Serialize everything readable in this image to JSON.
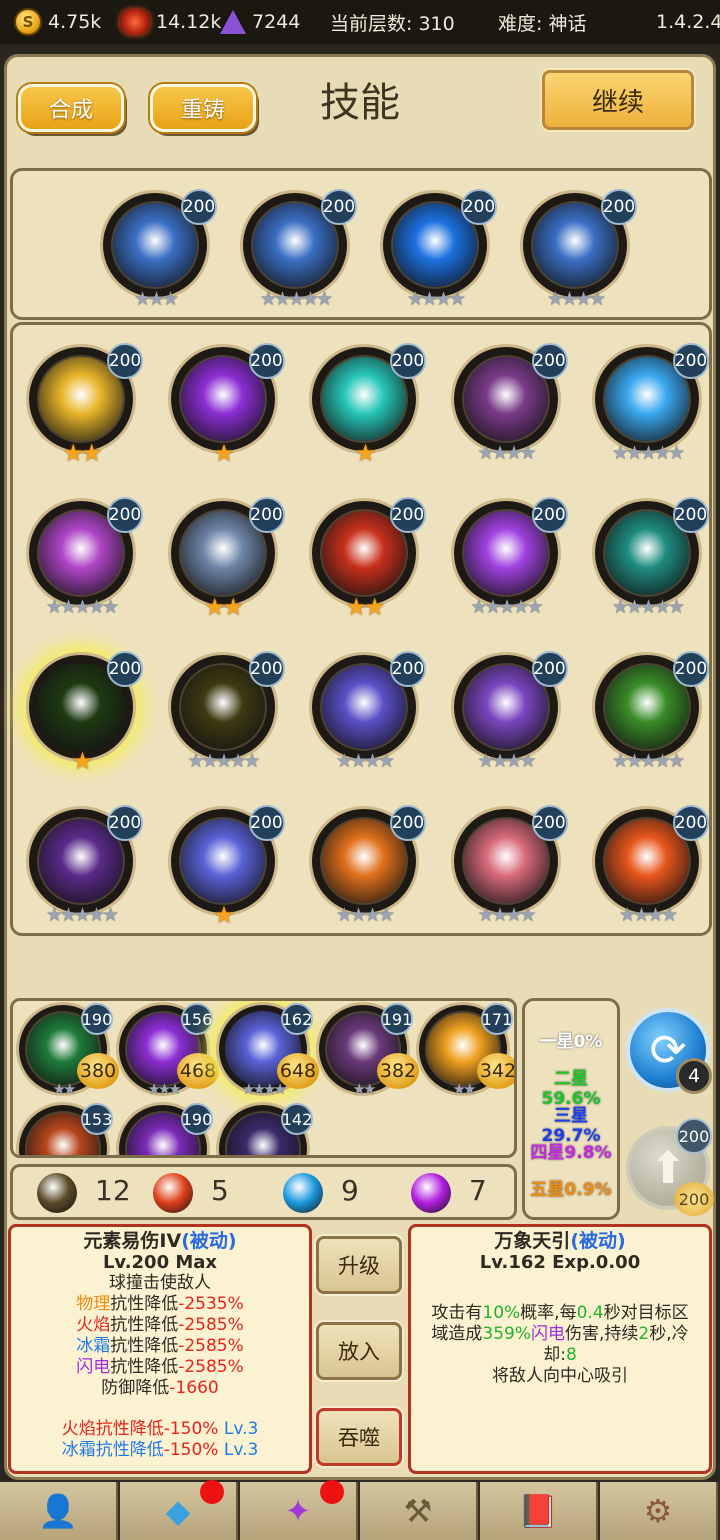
{
  "topbar": {
    "gold": "4.75k",
    "ore": "14.12k",
    "gems": "7244",
    "floor": "当前层数: 310",
    "difficulty": "难度: 神话",
    "version": "1.4.2.4",
    "coin_icon_glyph": "S"
  },
  "header": {
    "merge": "合成",
    "recast": "重铸",
    "title": "技能",
    "continue": "继续"
  },
  "equipped": [
    {
      "icon": "rock-ice-icon",
      "level": "200",
      "stars": "★★★",
      "color": "#3a6fc4"
    },
    {
      "icon": "rock-ice-icon",
      "level": "200",
      "stars": "★★★★★",
      "color": "#3a6fc4"
    },
    {
      "icon": "blue-energy-icon",
      "level": "200",
      "stars": "★★★★",
      "color": "#1c70e0"
    },
    {
      "icon": "rock-ice-icon",
      "level": "200",
      "stars": "★★★★",
      "color": "#3a6fc4"
    }
  ],
  "skills": [
    {
      "icon": "gold-card-icon",
      "level": "200",
      "stars": "★★",
      "gold": true,
      "color": "#e8b52a"
    },
    {
      "icon": "purple-lightning-icon",
      "level": "200",
      "stars": "★",
      "gold": true,
      "color": "#8c2ed4"
    },
    {
      "icon": "cyan-blades-icon",
      "level": "200",
      "stars": "★",
      "gold": true,
      "color": "#27c7b8"
    },
    {
      "icon": "fire-purple-icon",
      "level": "200",
      "stars": "★★★★",
      "gold": false,
      "color": "#7a3b8a"
    },
    {
      "icon": "blue-burst-icon",
      "level": "200",
      "stars": "★★★★★",
      "gold": false,
      "color": "#3aa8f0"
    },
    {
      "icon": "pink-vortex-icon",
      "level": "200",
      "stars": "★★★★★",
      "gold": false,
      "color": "#b046c8"
    },
    {
      "icon": "rock-cluster-icon",
      "level": "200",
      "stars": "★★",
      "gold": true,
      "color": "#6f86a8"
    },
    {
      "icon": "fire-warrior-icon",
      "level": "200",
      "stars": "★★",
      "gold": true,
      "color": "#c8301c"
    },
    {
      "icon": "star-purple-icon",
      "level": "200",
      "stars": "★★★★★",
      "gold": false,
      "color": "#a042e0"
    },
    {
      "icon": "green-slash-icon",
      "level": "200",
      "stars": "★★★★★",
      "gold": false,
      "color": "#1e8c80"
    },
    {
      "icon": "skull-icon",
      "level": "200",
      "stars": "★",
      "gold": true,
      "color": "#1e3a12",
      "glow": true
    },
    {
      "icon": "yellow-storm-icon",
      "level": "200",
      "stars": "★★★★★",
      "gold": false,
      "color": "#3e3a12"
    },
    {
      "icon": "deer-spirit-icon",
      "level": "200",
      "stars": "★★★★",
      "gold": false,
      "color": "#5a50c8"
    },
    {
      "icon": "deer-spirit-icon",
      "level": "200",
      "stars": "★★★★",
      "gold": false,
      "color": "#7a46c0"
    },
    {
      "icon": "green-fist-icon",
      "level": "200",
      "stars": "★★★★★",
      "gold": false,
      "color": "#3a8c28"
    },
    {
      "icon": "purple-storm-icon",
      "level": "200",
      "stars": "★★★★★",
      "gold": false,
      "color": "#5a2a8a"
    },
    {
      "icon": "spiral-icon",
      "level": "200",
      "stars": "★",
      "gold": true,
      "color": "#5a62d8"
    },
    {
      "icon": "fire-deer-icon",
      "level": "200",
      "stars": "★★★★",
      "gold": false,
      "color": "#e0701c"
    },
    {
      "icon": "pink-deer-icon",
      "level": "200",
      "stars": "★★★★",
      "gold": false,
      "color": "#d86a7a"
    },
    {
      "icon": "fire-swirl-icon",
      "level": "200",
      "stars": "★★★★",
      "gold": false,
      "color": "#e8561c"
    }
  ],
  "inventory": [
    {
      "icon": "green-lightning-icon",
      "level": "190",
      "count": "380",
      "stars": "★★",
      "color": "#1e7a3a"
    },
    {
      "icon": "purple-lightning-icon",
      "level": "156",
      "count": "468",
      "stars": "★★★",
      "color": "#8c2ed4"
    },
    {
      "icon": "spiral-icon",
      "level": "162",
      "count": "648",
      "stars": "★★★★",
      "color": "#5a62d8",
      "glow": true
    },
    {
      "icon": "gold-purple-icon",
      "level": "191",
      "count": "382",
      "stars": "★★",
      "color": "#6a3a7a"
    },
    {
      "icon": "sun-fire-icon",
      "level": "171",
      "count": "342",
      "stars": "★★",
      "color": "#f0a020"
    },
    {
      "icon": "fire-explosion-icon",
      "level": "153",
      "count": "",
      "stars": "",
      "color": "#b8461c"
    },
    {
      "icon": "purple-web-icon",
      "level": "190",
      "count": "",
      "stars": "",
      "color": "#7a2ab8"
    },
    {
      "icon": "red-sparkle-icon",
      "level": "142",
      "count": "",
      "stars": "",
      "color": "#3a2a6a"
    }
  ],
  "rates": [
    {
      "label": "一星0%",
      "color": "#ffffff"
    },
    {
      "label": "二星59.6%",
      "color": "#21c426"
    },
    {
      "label": "三星29.7%",
      "color": "#1f3ee8"
    },
    {
      "label": "四星9.8%",
      "color": "#c42ae0"
    },
    {
      "label": "五星0.9%",
      "color": "#f08c10"
    }
  ],
  "actions": {
    "refresh_badge": "4",
    "upgrade_badge": "200",
    "upgrade_cost": "200"
  },
  "resources": [
    {
      "color": "#5a4a28",
      "count": "12"
    },
    {
      "color": "#e0401a",
      "count": "5"
    },
    {
      "color": "#1c9ae0",
      "count": "9"
    },
    {
      "color": "#b21ee0",
      "count": "7"
    }
  ],
  "left_info": {
    "name": "元素易伤IV",
    "type": "(被动)",
    "level": "Lv.200 Max",
    "desc": "球撞击使敌人",
    "lines": [
      {
        "a": "物理",
        "b": "抗性降低",
        "c": "-2535%",
        "ca": "or"
      },
      {
        "a": "火焰",
        "b": "抗性降低",
        "c": "-2585%",
        "ca": "red"
      },
      {
        "a": "冰霜",
        "b": "抗性降低",
        "c": "-2585%",
        "ca": "bl"
      },
      {
        "a": "闪电",
        "b": "抗性降低",
        "c": "-2585%",
        "ca": "pu"
      }
    ],
    "defense": "防御降低",
    "defense_val": "-1660",
    "extra": [
      {
        "a": "火焰",
        "b": "抗性降低",
        "c": "-150%",
        "lv": "Lv.3",
        "ca": "red"
      },
      {
        "a": "冰霜",
        "b": "抗性降低",
        "c": "-150%",
        "lv": "Lv.3",
        "ca": "bl"
      }
    ]
  },
  "mid_buttons": {
    "upgrade": "升级",
    "put": "放入",
    "devour": "吞噬"
  },
  "right_info": {
    "name": "万象天引",
    "type": "(被动)",
    "level": "Lv.162 Exp.0.00",
    "p1": "攻击有",
    "v1": "10%",
    "p2": "概率,每",
    "v2": "0.4",
    "p3": "秒对目标区",
    "p4": "域造成",
    "v3": "359%",
    "p5": "闪电",
    "p6": "伤害,持续",
    "v4": "2",
    "p7": "秒,冷",
    "p8": "却:",
    "v5": "8",
    "p9": "将敌人向中心吸引"
  },
  "nav": [
    {
      "icon": "hero-icon",
      "dot": false
    },
    {
      "icon": "crystal-icon",
      "dot": true
    },
    {
      "icon": "magic-hand-icon",
      "dot": true
    },
    {
      "icon": "anvil-icon",
      "dot": false
    },
    {
      "icon": "book-icon",
      "dot": false
    },
    {
      "icon": "gear-icon",
      "dot": false
    }
  ]
}
